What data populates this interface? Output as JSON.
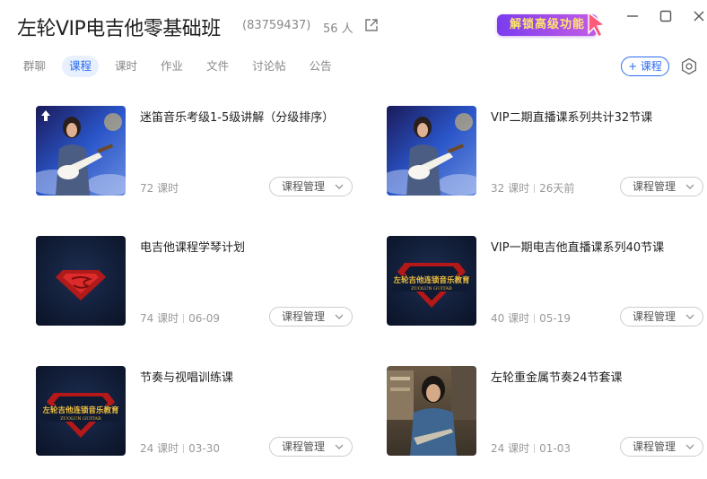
{
  "header": {
    "title": "左轮VIP电吉他零基础班",
    "group_id": "(83759437)",
    "members": "56 人",
    "unlock_label": "解锁高级功能"
  },
  "tabs": [
    {
      "label": "群聊",
      "active": false
    },
    {
      "label": "课程",
      "active": true
    },
    {
      "label": "课时",
      "active": false
    },
    {
      "label": "作业",
      "active": false
    },
    {
      "label": "文件",
      "active": false
    },
    {
      "label": "讨论帖",
      "active": false
    },
    {
      "label": "公告",
      "active": false
    }
  ],
  "toolbar": {
    "add_course_label": "+ 课程"
  },
  "courses": [
    {
      "title": "迷笛音乐考级1-5级讲解（分级排序）",
      "lessons": "72 课时",
      "date": "",
      "manage_label": "课程管理",
      "thumb": "guitarist-stage",
      "pinned": true
    },
    {
      "title": "VIP二期直播课系列共计32节课",
      "lessons": "32 课时",
      "date": "26天前",
      "manage_label": "课程管理",
      "thumb": "guitarist-stage",
      "pinned": false
    },
    {
      "title": "电吉他课程学琴计划",
      "lessons": "74 课时",
      "date": "06-09",
      "manage_label": "课程管理",
      "thumb": "superman-logo",
      "pinned": false
    },
    {
      "title": "VIP一期电吉他直播课系列40节课",
      "lessons": "40 课时",
      "date": "05-19",
      "manage_label": "课程管理",
      "thumb": "zuolun-logo",
      "pinned": false
    },
    {
      "title": "节奏与视唱训练课",
      "lessons": "24 课时",
      "date": "03-30",
      "manage_label": "课程管理",
      "thumb": "zuolun-logo",
      "pinned": false
    },
    {
      "title": "左轮重金属节奏24节套课",
      "lessons": "24 课时",
      "date": "01-03",
      "manage_label": "课程管理",
      "thumb": "guitarist-room",
      "pinned": false
    }
  ],
  "logo_text": {
    "cn": "左轮吉他连锁音乐教育",
    "en": "ZUOLUN GUITAR"
  },
  "colors": {
    "accent": "#2b6bf0",
    "active_tab_bg": "#e8f0fe",
    "badge_gradient_start": "#7a3cf0",
    "badge_text": "#ffe66b"
  }
}
